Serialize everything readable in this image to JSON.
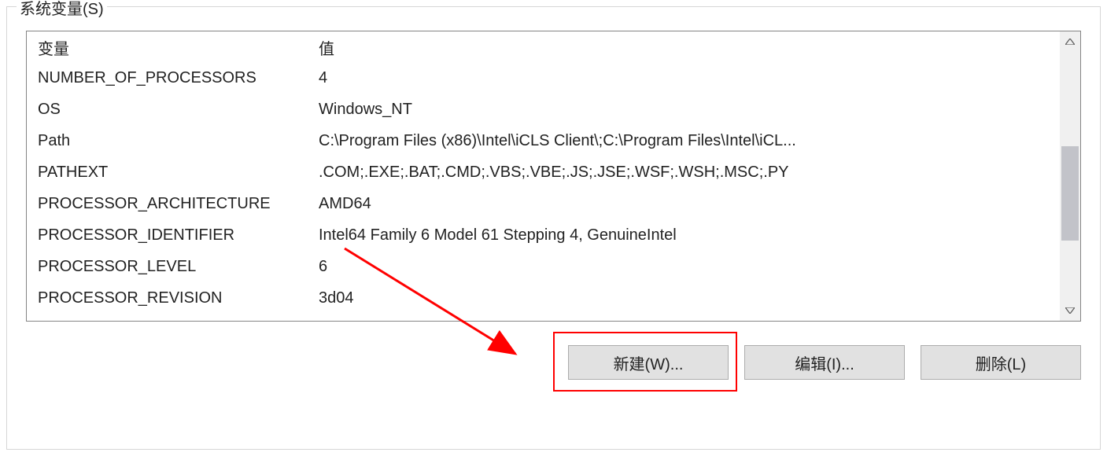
{
  "group": {
    "title": "系统变量(S)"
  },
  "columns": {
    "name": "变量",
    "value": "值"
  },
  "variables": [
    {
      "name": "NUMBER_OF_PROCESSORS",
      "value": "4"
    },
    {
      "name": "OS",
      "value": "Windows_NT"
    },
    {
      "name": "Path",
      "value": "C:\\Program Files (x86)\\Intel\\iCLS Client\\;C:\\Program Files\\Intel\\iCL..."
    },
    {
      "name": "PATHEXT",
      "value": ".COM;.EXE;.BAT;.CMD;.VBS;.VBE;.JS;.JSE;.WSF;.WSH;.MSC;.PY"
    },
    {
      "name": "PROCESSOR_ARCHITECTURE",
      "value": "AMD64"
    },
    {
      "name": "PROCESSOR_IDENTIFIER",
      "value": "Intel64 Family 6 Model 61 Stepping 4, GenuineIntel"
    },
    {
      "name": "PROCESSOR_LEVEL",
      "value": "6"
    },
    {
      "name": "PROCESSOR_REVISION",
      "value": "3d04"
    }
  ],
  "buttons": {
    "new": "新建(W)...",
    "edit": "编辑(I)...",
    "delete": "删除(L)"
  }
}
